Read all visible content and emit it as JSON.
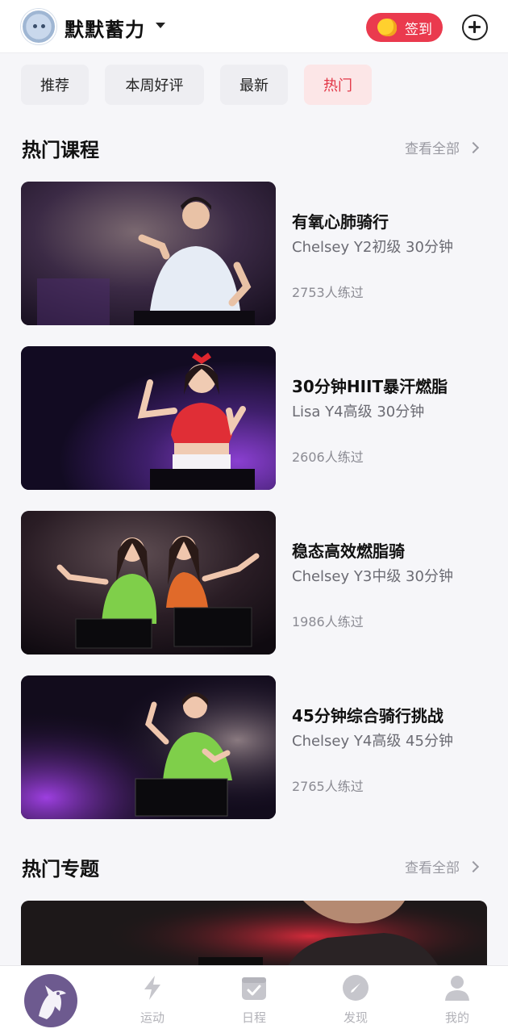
{
  "header": {
    "username": "默默蓄力",
    "signin_label": "签到"
  },
  "tabs": [
    {
      "label": "推荐",
      "active": false
    },
    {
      "label": "本周好评",
      "active": false
    },
    {
      "label": "最新",
      "active": false
    },
    {
      "label": "热门",
      "active": true
    }
  ],
  "hot_courses": {
    "title": "热门课程",
    "view_all": "查看全部",
    "items": [
      {
        "title": "有氧心肺骑行",
        "meta": "Chelsey Y2初级 30分钟",
        "count": "2753人练过"
      },
      {
        "title": "30分钟HIIT暴汗燃脂",
        "meta": "Lisa Y4高级 30分钟",
        "count": "2606人练过"
      },
      {
        "title": "稳态高效燃脂骑",
        "meta": "Chelsey Y3中级 30分钟",
        "count": "1986人练过"
      },
      {
        "title": "45分钟综合骑行挑战",
        "meta": "Chelsey Y4高级 45分钟",
        "count": "2765人练过"
      }
    ]
  },
  "hot_topics": {
    "title": "热门专题",
    "view_all": "查看全部"
  },
  "bottom_nav": [
    {
      "label": "运动",
      "icon": "lightning-icon"
    },
    {
      "label": "日程",
      "icon": "calendar-check-icon"
    },
    {
      "label": "发现",
      "icon": "compass-icon"
    },
    {
      "label": "我的",
      "icon": "person-icon"
    }
  ],
  "colors": {
    "accent": "#ea3a4e",
    "active_tab_bg": "#fce6e7",
    "active_tab_text": "#e23646",
    "nav_inactive": "#b2b2b8",
    "logo_bg": "#6d5a8f"
  }
}
